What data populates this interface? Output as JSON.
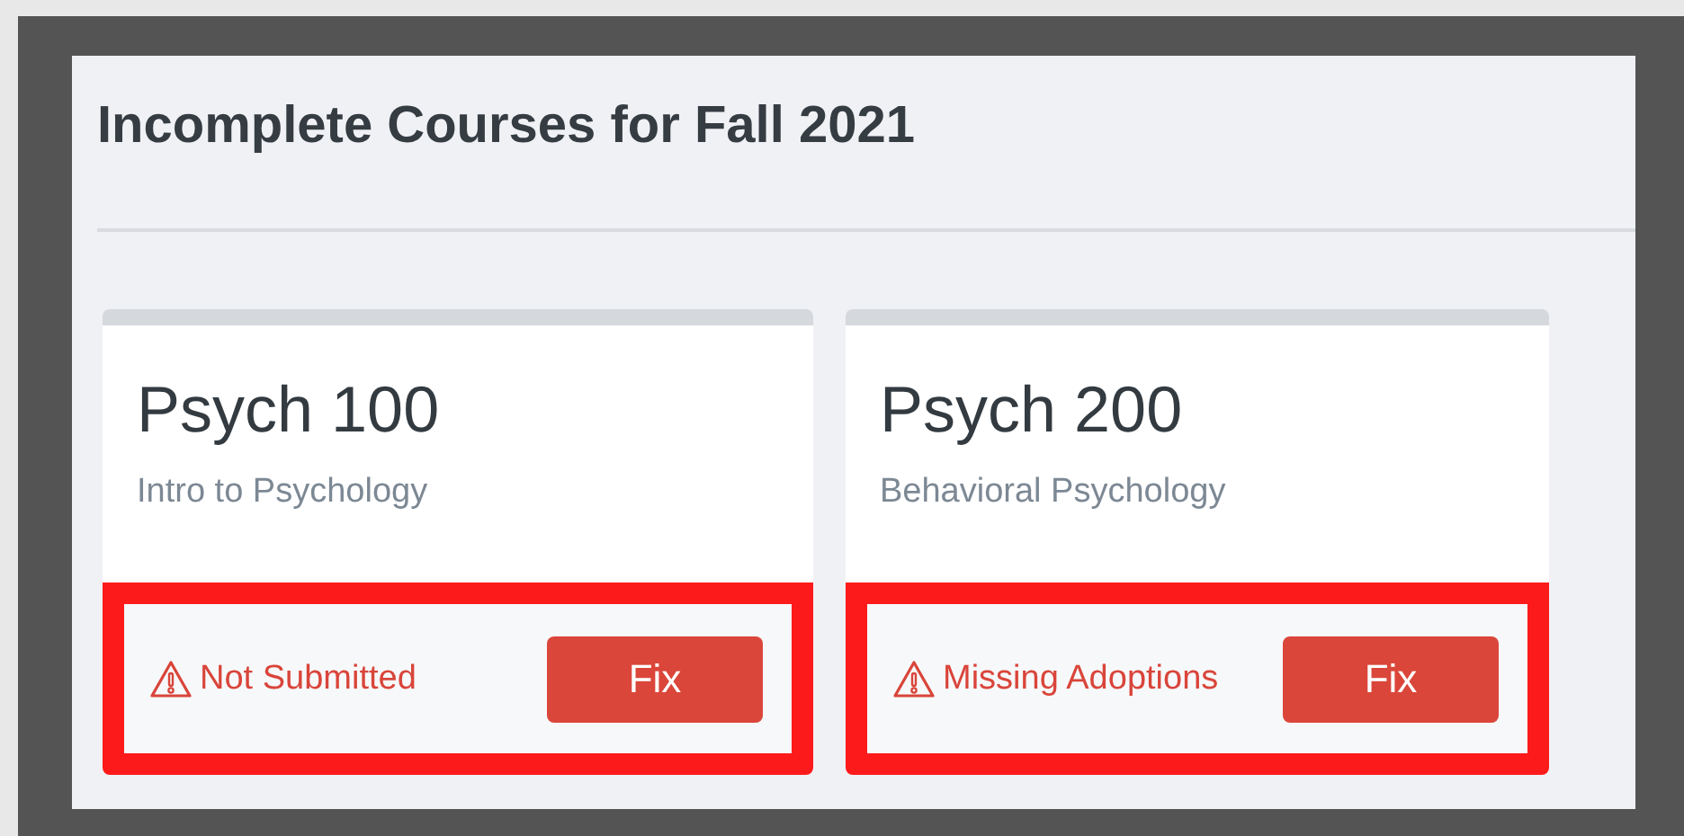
{
  "heading": "Incomplete Courses for Fall 2021",
  "courses": [
    {
      "code": "Psych 100",
      "name": "Intro to Psychology",
      "status": "Not Submitted",
      "action": "Fix",
      "highlighted": true
    },
    {
      "code": "Psych 200",
      "name": "Behavioral Psychology",
      "status": "Missing Adoptions",
      "action": "Fix",
      "highlighted": true
    }
  ]
}
